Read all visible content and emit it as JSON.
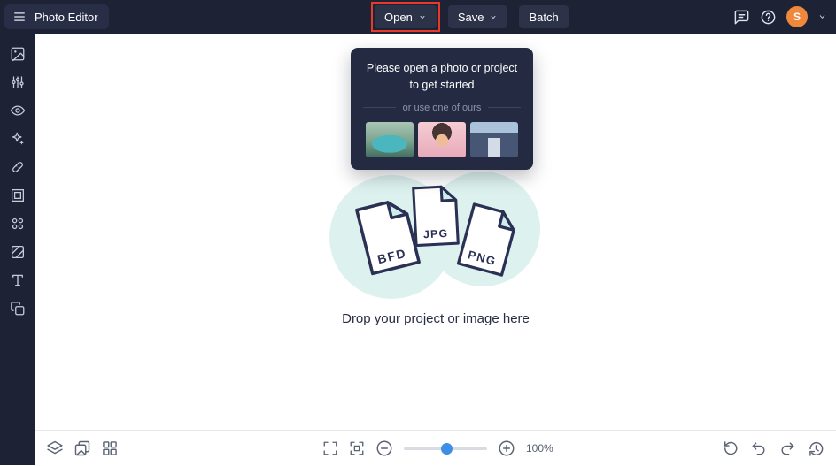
{
  "topbar": {
    "app_title": "Photo Editor",
    "buttons": {
      "open": "Open",
      "save": "Save",
      "batch": "Batch"
    },
    "avatar_initial": "S",
    "icons": [
      "hamburger-icon",
      "chevron-down-icon",
      "feedback-icon",
      "help-icon",
      "avatar",
      "chevron-down-icon"
    ]
  },
  "sidebar": {
    "icons": [
      "image-icon",
      "adjustments-icon",
      "eye-icon",
      "effects-icon",
      "touchup-icon",
      "frames-icon",
      "graphics-icon",
      "overlays-icon",
      "text-icon",
      "duplicate-icon"
    ]
  },
  "tooltip": {
    "message": "Please open a photo or project to get started",
    "divider_label": "or use one of ours",
    "samples": [
      "van-sample",
      "portrait-sample",
      "canal-sample"
    ]
  },
  "canvas": {
    "drop_text": "Drop your project or image here",
    "file_types": [
      "BFD",
      "JPG",
      "PNG"
    ]
  },
  "bottombar": {
    "zoom_level": "100%",
    "left_icons": [
      "layers-icon",
      "image-manager-icon",
      "grid-icon"
    ],
    "center_icons": [
      "fullscreen-icon",
      "fit-screen-icon",
      "zoom-out-icon",
      "zoom-slider",
      "zoom-in-icon"
    ],
    "right_icons": [
      "refresh-icon",
      "undo-icon",
      "redo-icon",
      "history-icon"
    ]
  },
  "colors": {
    "topbar_bg": "#1d2235",
    "button_bg": "#2c3248",
    "annotation_red": "#e8392b",
    "avatar_orange": "#f0883c",
    "tooltip_bg": "#242a42",
    "blob_mint": "#ddf2ef",
    "paper_outline": "#2b3154",
    "slider_handle_blue": "#3e8ee6"
  }
}
